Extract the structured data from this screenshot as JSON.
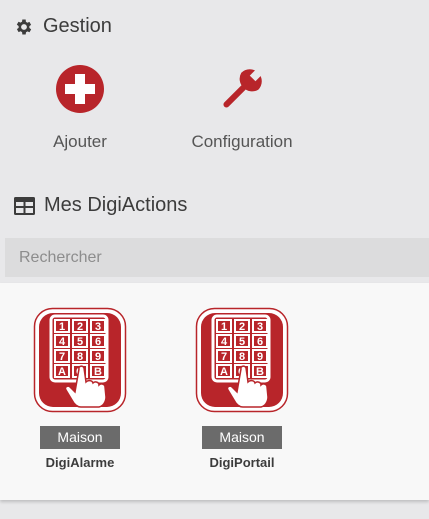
{
  "gestion": {
    "title": "Gestion",
    "icon": "gear-icon",
    "tiles": [
      {
        "label": "Ajouter",
        "icon": "plus-circle-icon"
      },
      {
        "label": "Configuration",
        "icon": "wrench-icon"
      }
    ]
  },
  "actions": {
    "title": "Mes DigiActions",
    "icon": "table-icon",
    "search": {
      "placeholder": "Rechercher",
      "value": ""
    },
    "items": [
      {
        "badge": "Maison",
        "name": "DigiAlarme",
        "icon": "keypad-icon"
      },
      {
        "badge": "Maison",
        "name": "DigiPortail",
        "icon": "keypad-icon"
      }
    ]
  },
  "colors": {
    "accent": "#b8252a",
    "background": "#e8e8ea",
    "panel": "#f8f8f8",
    "badge": "#6b6b6b"
  }
}
